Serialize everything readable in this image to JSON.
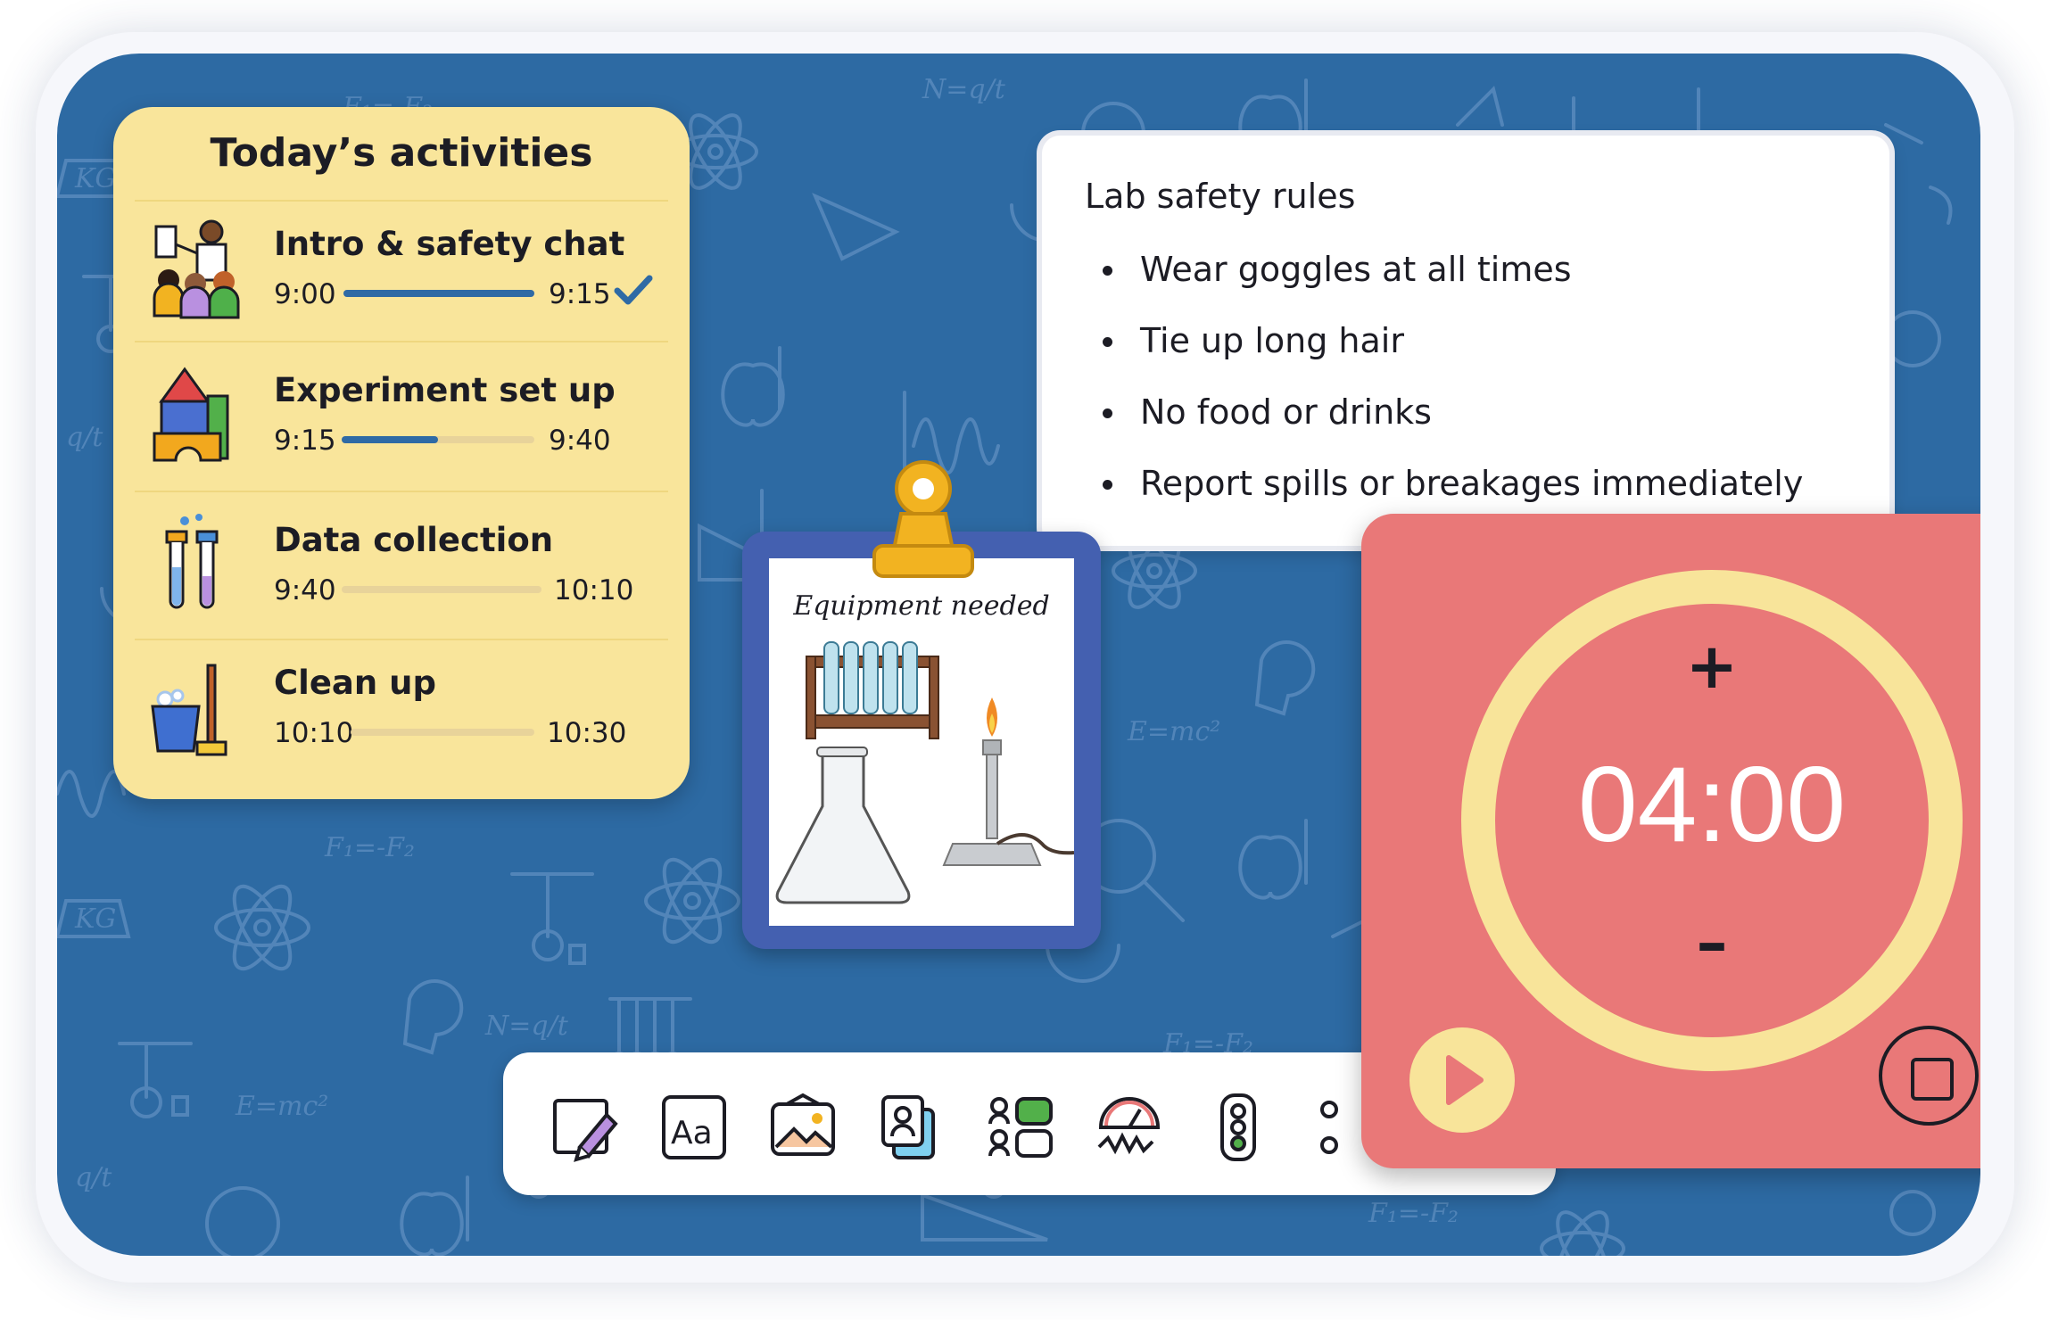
{
  "activities": {
    "title": "Today’s activities",
    "items": [
      {
        "title": "Intro & safety chat",
        "start": "9:00",
        "end": "9:15",
        "progress": 1.0,
        "done": true,
        "icon": "teacher-presenting-icon"
      },
      {
        "title": "Experiment set up",
        "start": "9:15",
        "end": "9:40",
        "progress": 0.5,
        "done": false,
        "icon": "building-blocks-icon"
      },
      {
        "title": "Data collection",
        "start": "9:40",
        "end": "10:10",
        "progress": 0.0,
        "done": false,
        "icon": "test-tubes-icon"
      },
      {
        "title": "Clean up",
        "start": "10:10",
        "end": "10:30",
        "progress": 0.0,
        "done": false,
        "icon": "mop-bucket-icon"
      }
    ]
  },
  "rules": {
    "title": "Lab safety rules",
    "items": [
      "Wear goggles at all times",
      "Tie up long hair",
      "No food or drinks",
      "Report spills or breakages immediately"
    ]
  },
  "clipboard": {
    "title": "Equipment needed"
  },
  "timer": {
    "value": "04:00",
    "plus_label": "+",
    "minus_label": "–"
  },
  "toolbar": {
    "tools": [
      "draw-icon",
      "text-icon",
      "image-icon",
      "name-picker-icon",
      "group-maker-icon",
      "sound-level-icon",
      "traffic-light-icon"
    ]
  },
  "colors": {
    "board": "#2d6aa3",
    "activities_bg": "#f9e59b",
    "progress": "#2f6aa5",
    "timer_bg": "#e97878",
    "timer_ring": "#f8e49a",
    "clipboard": "#4460b0"
  }
}
